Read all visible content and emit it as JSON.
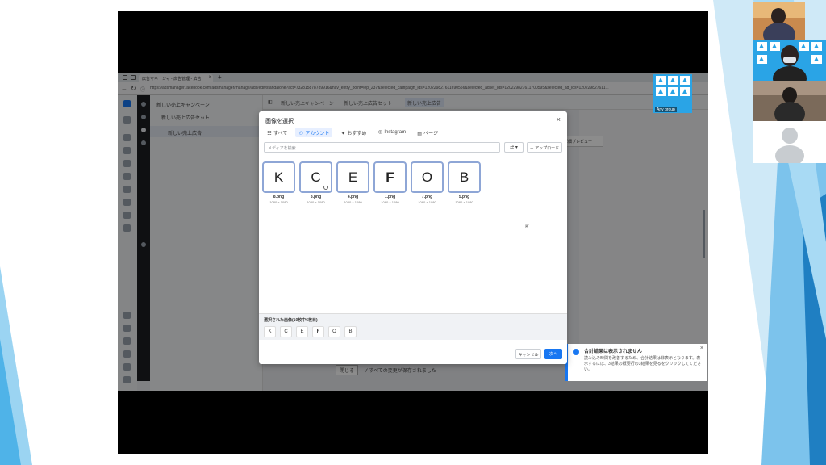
{
  "browser": {
    "tab_title": "広告マネージャ - 広告管理 - 広告",
    "url": "https://adsmanager.facebook.com/adsmanager/manage/ads/edit/standalone?act=732815878789916&nav_entry_point=lep_237&selected_campaign_ids=120229827611690556&selected_adset_ids=120229827611700595&selected_ad_ids=120229827611..."
  },
  "ads_manager": {
    "tree": {
      "campaign": "新しい売上キャンペーン",
      "adset": "新しい売上広告セット",
      "ad": "新しい売上広告"
    },
    "breadcrumbs": [
      "新しい売上キャンペーン",
      "新しい売上広告セット",
      "新しい売上広告"
    ],
    "preview_button": "詳細プレビュー",
    "close_button": "閉じる",
    "saved_status": "すべての変更が保存されました"
  },
  "modal": {
    "title": "画像を選択",
    "tabs": [
      {
        "label": "すべて",
        "icon": "list-icon"
      },
      {
        "label": "アカウント",
        "icon": "person-icon",
        "selected": true
      },
      {
        "label": "おすすめ",
        "icon": "sparkle-icon"
      },
      {
        "label": "Instagram",
        "icon": "instagram-icon"
      },
      {
        "label": "ページ",
        "icon": "page-icon"
      }
    ],
    "search_placeholder": "メディアを検索",
    "filter_glyph": "⇄ ▾",
    "upload_label": "＋ アップロード",
    "images": [
      {
        "letter": "K",
        "file": "8.png",
        "dims": "1080 × 1080"
      },
      {
        "letter": "C",
        "file": "3.png",
        "dims": "1080 × 1080"
      },
      {
        "letter": "E",
        "file": "4.png",
        "dims": "1080 × 1080"
      },
      {
        "letter": "F",
        "file": "1.png",
        "dims": "1080 × 1080"
      },
      {
        "letter": "O",
        "file": "7.png",
        "dims": "1080 × 1080"
      },
      {
        "letter": "B",
        "file": "5.png",
        "dims": "1080 × 1080"
      }
    ],
    "selected_label": "選択された画像(10枚中6枚目)",
    "selected_chips": [
      "K",
      "C",
      "E",
      "F",
      "O",
      "B"
    ],
    "cancel_label": "キャンセル",
    "next_label": "次へ"
  },
  "notification": {
    "title": "合計結果は表示されません",
    "body": "読み込み時間を改善するため、合計結果は非表示となります。表示するには、3結果の概要行の3結果を見るをクリックしてください。"
  },
  "participants": [
    {
      "name": "",
      "kind": "camera"
    },
    {
      "name": "Any group",
      "kind": "logo-wall"
    },
    {
      "name": "",
      "kind": "camera-mask"
    },
    {
      "name": "",
      "kind": "camera"
    },
    {
      "name": "",
      "kind": "avatar-placeholder"
    }
  ],
  "colors": {
    "accent": "#1877f2",
    "thumb_border": "#8ea6d6",
    "slide_blue": "#2aa4e6"
  }
}
